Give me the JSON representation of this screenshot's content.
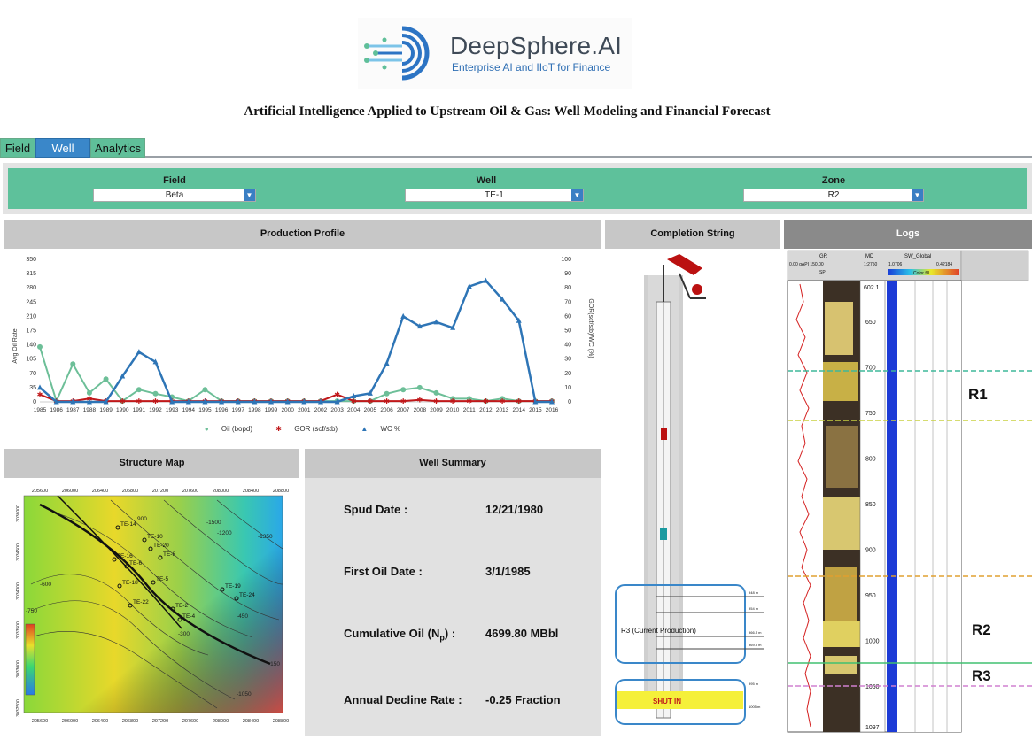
{
  "brand": {
    "name": "DeepSphere.AI",
    "tagline": "Enterprise AI and IIoT for Finance"
  },
  "page_title": "Artificial Intelligence Applied to Upstream Oil & Gas: Well Modeling and Financial Forecast",
  "tabs": [
    {
      "label": "Field",
      "active": false
    },
    {
      "label": "Well",
      "active": true
    },
    {
      "label": "Analytics",
      "active": false
    }
  ],
  "filters": {
    "field": {
      "label": "Field",
      "value": "Beta"
    },
    "well": {
      "label": "Well",
      "value": "TE-1"
    },
    "zone": {
      "label": "Zone",
      "value": "R2"
    }
  },
  "panels": {
    "production": "Production Profile",
    "completion": "Completion String",
    "logs": "Logs",
    "structure": "Structure Map",
    "summary": "Well Summary"
  },
  "colors": {
    "accent_green": "#5ec19b",
    "accent_blue": "#3a87c9",
    "oil": "#6dbf98",
    "gor": "#c0181a",
    "wc": "#2e75b6"
  },
  "chart_data": {
    "type": "line",
    "title": "",
    "xlabel": "",
    "ylabel": "Avg Oil Rate",
    "y2label": "GOR(scf/stb)/WC (%)",
    "ylim": [
      0,
      350
    ],
    "y2lim": [
      0,
      100
    ],
    "yticks": [
      0,
      35,
      70,
      105,
      140,
      175,
      210,
      245,
      280,
      315,
      350
    ],
    "y2ticks": [
      0,
      10,
      20,
      30,
      40,
      50,
      60,
      70,
      80,
      90,
      100
    ],
    "categories": [
      "1985",
      "1986",
      "1987",
      "1988",
      "1989",
      "1990",
      "1991",
      "1992",
      "1993",
      "1994",
      "1995",
      "1996",
      "1997",
      "1998",
      "1999",
      "2000",
      "2001",
      "2002",
      "2003",
      "2004",
      "2005",
      "2006",
      "2007",
      "2008",
      "2009",
      "2010",
      "2011",
      "2012",
      "2013",
      "2014",
      "2015",
      "2016"
    ],
    "series": [
      {
        "name": "Oil (bopd)",
        "axis": "left",
        "marker": "circle",
        "values": [
          135,
          2,
          93,
          22,
          56,
          2,
          30,
          20,
          12,
          2,
          30,
          2,
          2,
          2,
          2,
          2,
          2,
          2,
          2,
          2,
          2,
          20,
          30,
          35,
          22,
          8,
          8,
          2,
          8,
          2,
          2,
          2
        ]
      },
      {
        "name": "GOR (scf/stb)",
        "axis": "left",
        "marker": "star",
        "values": [
          18,
          2,
          2,
          8,
          2,
          2,
          2,
          2,
          2,
          2,
          2,
          2,
          2,
          2,
          2,
          2,
          2,
          2,
          18,
          2,
          2,
          2,
          2,
          5,
          2,
          2,
          2,
          2,
          2,
          2,
          2,
          2
        ]
      },
      {
        "name": "WC %",
        "axis": "right",
        "marker": "triangle",
        "values": [
          10,
          0,
          0,
          0,
          0,
          18,
          35,
          28,
          0,
          0,
          0,
          0,
          0,
          0,
          0,
          0,
          0,
          0,
          0,
          4,
          6,
          27,
          60,
          53,
          56,
          52,
          81,
          85,
          72,
          57,
          0,
          0
        ]
      }
    ],
    "legend_position": "bottom"
  },
  "well_summary": {
    "spud_label": "Spud Date :",
    "spud_value": "12/21/1980",
    "first_oil_label": "First Oil Date :",
    "first_oil_value": "3/1/1985",
    "cum_oil_label": "Cumulative Oil (N",
    "cum_oil_sub": "p",
    "cum_oil_label_end": ") :",
    "cum_oil_value": "4699.80 MBbl",
    "decline_label": "Annual Decline Rate :",
    "decline_value": "-0.25 Fraction"
  },
  "completion": {
    "zone_label": "R3 (Current Production)",
    "shut_in": "SHUT IN",
    "depths": [
      "948 m",
      "954 m",
      "966.5 m",
      "969.5 m",
      "995 m",
      "1005 m"
    ]
  },
  "structure_map": {
    "x_ticks": [
      "205600",
      "206000",
      "206400",
      "206800",
      "207200",
      "207600",
      "208000",
      "208400",
      "208800"
    ],
    "y_ticks_left": [
      "3036000",
      "3034500",
      "3034000",
      "3033500",
      "3033000",
      "3032500"
    ],
    "wells": [
      "TE-14",
      "TE-10",
      "TE-20",
      "TE-8",
      "TE-16",
      "TE-6",
      "TE-18",
      "TE-22",
      "TE-5",
      "TE-19",
      "TE-24",
      "TE-2",
      "TE-4"
    ],
    "contours": [
      "900",
      "-750",
      "-600",
      "-450",
      "-300",
      "-1050",
      "-1200",
      "-1350",
      "-1500",
      "-150"
    ]
  },
  "logs": {
    "track_headers": {
      "gr": "GR",
      "md": "MD",
      "sw": "SW_Global",
      "sp": "SP",
      "fill": "Color fill"
    },
    "gr_scale": "0.00  gAPI  150.00",
    "md_scale": "1:2750",
    "sw_scale_left": "1.0706",
    "sw_scale_right": "0.42184",
    "depth_top": "602.1",
    "depth_ticks": [
      "650",
      "700",
      "750",
      "800",
      "850",
      "900",
      "950",
      "1000",
      "1050",
      "1097"
    ],
    "zones": [
      "R1",
      "R2",
      "R3"
    ]
  }
}
